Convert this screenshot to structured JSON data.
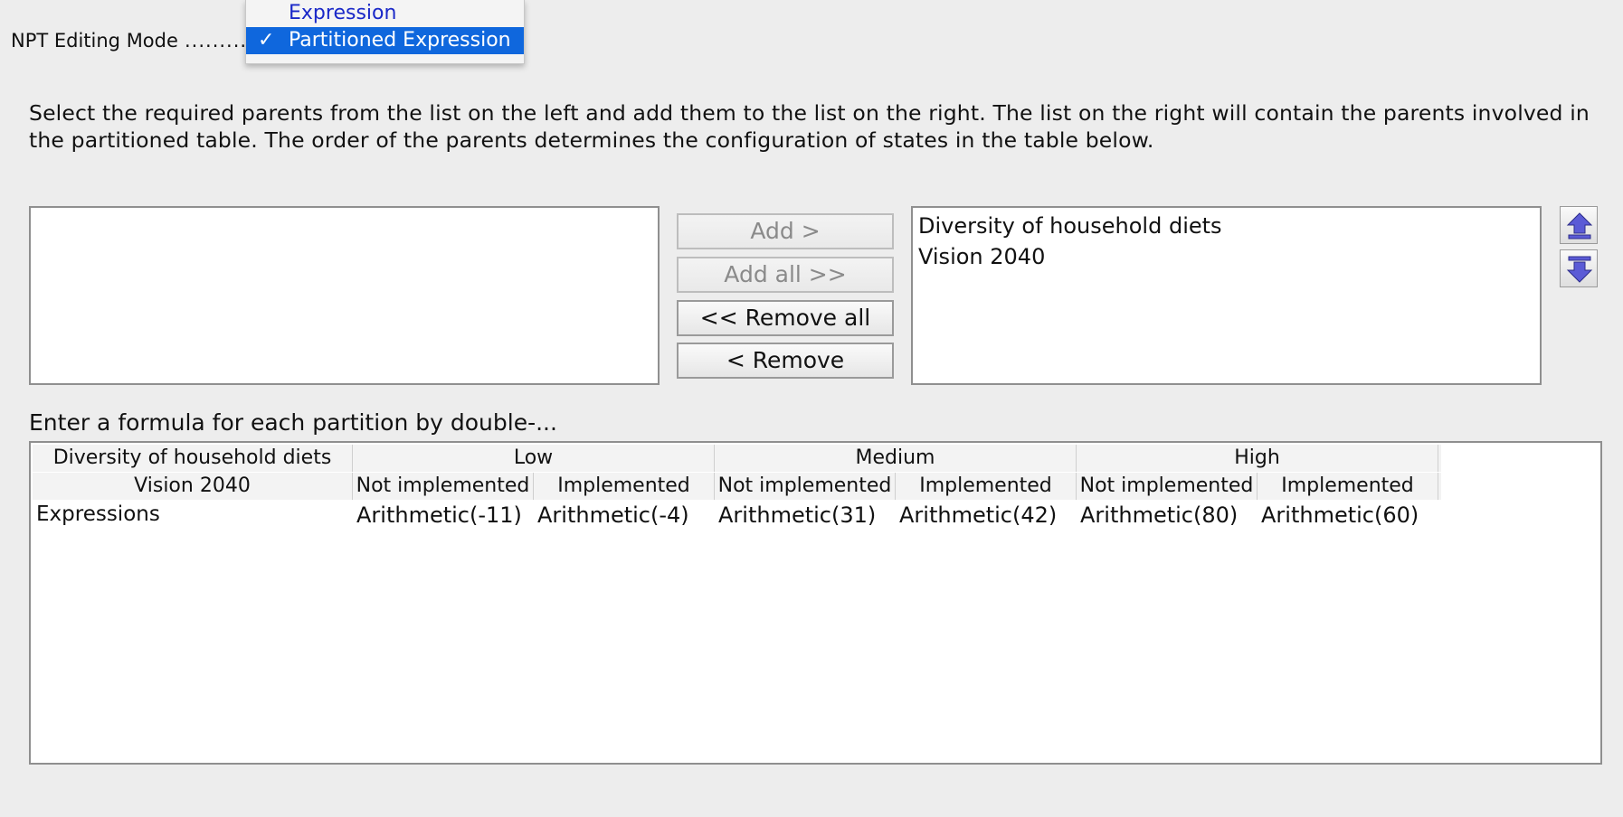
{
  "mode_selector": {
    "label": "NPT Editing Mode",
    "dots": "..........",
    "options": [
      {
        "label": "Expression",
        "selected": false
      },
      {
        "label": "Partitioned Expression",
        "selected": true
      }
    ],
    "check_mark": "✓"
  },
  "instructions": "Select the required parents from the list on the left and add them to the list on the right. The list on the right will contain the parents involved in the partitioned table. The order of the parents determines the configuration of states in the table below.",
  "available_parents": [],
  "selected_parents": [
    "Diversity of household diets",
    "Vision 2040"
  ],
  "buttons": {
    "add": {
      "label": "Add >",
      "enabled": false
    },
    "add_all": {
      "label": "Add all >>",
      "enabled": false
    },
    "remove_all": {
      "label": "<< Remove all",
      "enabled": true
    },
    "remove": {
      "label": "< Remove",
      "enabled": true
    },
    "move_up_icon": "arrow-up-icon",
    "move_down_icon": "arrow-down-icon"
  },
  "formula_label": "Enter a formula for each partition by double-...",
  "table": {
    "row1_header": "Diversity of household diets",
    "row1_groups": [
      "Low",
      "Medium",
      "High"
    ],
    "row2_header": "Vision 2040",
    "row2_states": [
      "Not implemented",
      "Implemented",
      "Not implemented",
      "Implemented",
      "Not implemented",
      "Implemented"
    ],
    "row_label": "Expressions",
    "expressions": [
      "Arithmetic(-11)",
      "Arithmetic(-4)",
      "Arithmetic(31)",
      "Arithmetic(42)",
      "Arithmetic(80)",
      "Arithmetic(60)"
    ]
  },
  "colors": {
    "selection": "#0f67dd",
    "link_text": "#1a28c8",
    "arrow_icon": "#5b5bd6"
  }
}
